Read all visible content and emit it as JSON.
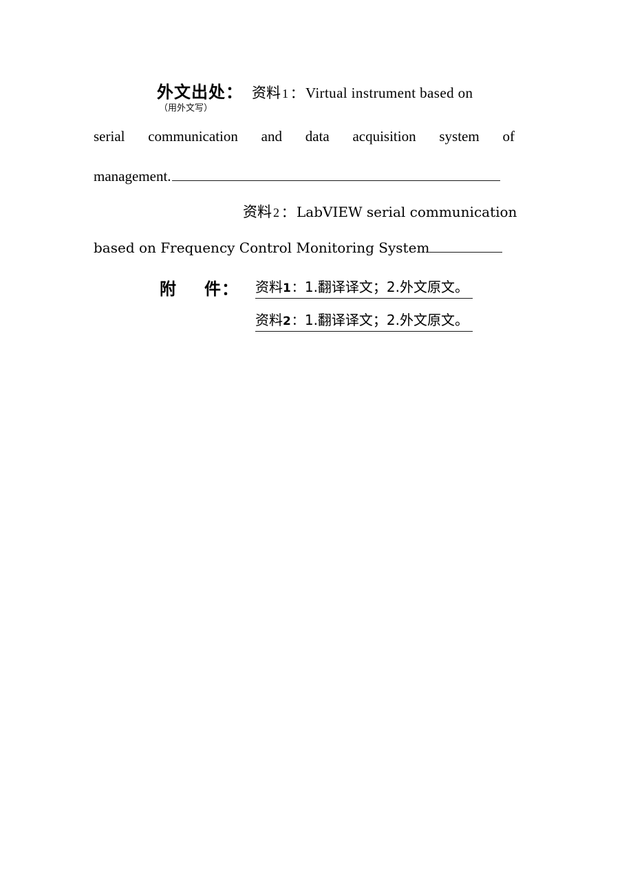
{
  "document": {
    "type": "form-page",
    "background_color": "#ffffff",
    "text_color": "#000000"
  },
  "source_field": {
    "label": "外文出处：",
    "label_note": "（用外文写）",
    "item1_prefix": "资料",
    "item1_number": "1",
    "item1_colon": "：",
    "title_line1": "Virtual  instrument  based  on",
    "title_line2_words": [
      "serial",
      "communication",
      "and",
      "data",
      "acquisition",
      "system",
      "of"
    ],
    "title_line3": "management.",
    "item2_prefix": "资料",
    "item2_number": "2",
    "item2_colon": "：",
    "title2_line1": "LabVIEW serial communication",
    "title2_line2": "based on Frequency Control Monitoring System"
  },
  "attachment_field": {
    "label_char1": "附",
    "label_char2": "件：",
    "rows": [
      {
        "prefix": "资料",
        "number": "1",
        "colon": "：",
        "content": "1.翻译译文；2.外文原文。"
      },
      {
        "prefix": "资料",
        "number": "2",
        "colon": "：",
        "content": "1.翻译译文；2.外文原文。"
      }
    ]
  }
}
